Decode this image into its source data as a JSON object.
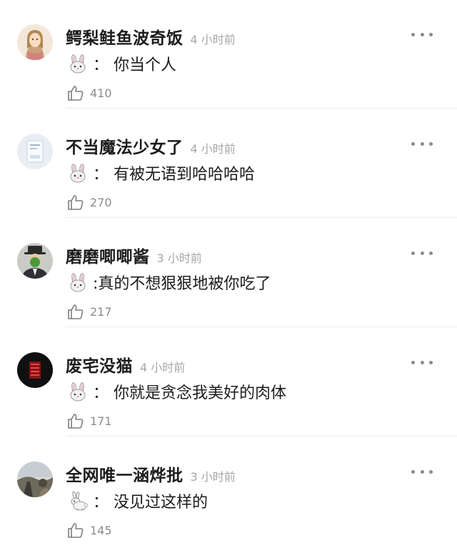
{
  "comments": [
    {
      "username": "鳄梨鲑鱼波奇饭",
      "time": "4 小时前",
      "emoji": "rabbit-face-icon",
      "text": "： 你当个人",
      "likes": "410",
      "avatar": "girl-illustration"
    },
    {
      "username": "不当魔法少女了",
      "time": "4 小时前",
      "emoji": "rabbit-face-icon",
      "text": "： 有被无语到哈哈哈哈",
      "likes": "270",
      "avatar": "book-cover"
    },
    {
      "username": "磨磨唧唧酱",
      "time": "3 小时前",
      "emoji": "rabbit-face-icon",
      "text": ":真的不想狠狠地被你吃了",
      "likes": "217",
      "avatar": "man-with-apple"
    },
    {
      "username": "废宅没猫",
      "time": "4 小时前",
      "emoji": "rabbit-face-icon",
      "text": "： 你就是贪念我美好的肉体",
      "likes": "171",
      "avatar": "red-sign-dark"
    },
    {
      "username": "全网唯一涵烨批",
      "time": "3 小时前",
      "emoji": "rabbit-icon",
      "text": "： 没见过这样的",
      "likes": "145",
      "avatar": "landscape-photo"
    }
  ],
  "colors": {
    "username": "#1c1c1c",
    "time": "#a6a6a6",
    "likes": "#8c8c8c",
    "divider": "#ececec"
  },
  "icons": {
    "like": "thumbs-up-icon",
    "more": "more-dots-icon"
  }
}
